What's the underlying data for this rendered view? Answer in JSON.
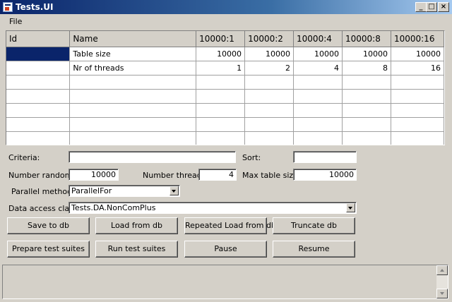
{
  "window": {
    "title": "Tests.UI",
    "minimize_glyph": "_",
    "maximize_glyph": "□",
    "close_glyph": "×"
  },
  "menu": {
    "file": "File"
  },
  "grid": {
    "columns": [
      "Id",
      "Name",
      "10000:1",
      "10000:2",
      "10000:4",
      "10000:8",
      "10000:16"
    ],
    "rows": [
      [
        "",
        "Table size",
        "10000",
        "10000",
        "10000",
        "10000",
        "10000"
      ],
      [
        "",
        "Nr of threads",
        "1",
        "2",
        "4",
        "8",
        "16"
      ]
    ]
  },
  "form": {
    "criteria_label": "Criteria:",
    "criteria_value": "",
    "sort_label": "Sort:",
    "sort_value": "",
    "number_randoms_label": "Number randoms:",
    "number_randoms_value": "10000",
    "number_threads_label": "Number threads:",
    "number_threads_value": "4",
    "max_table_size_label": "Max table size:",
    "max_table_size_value": "10000",
    "parallel_method_label": "Parallel method:",
    "parallel_method_value": "ParallelFor",
    "data_access_label": "Data access class:",
    "data_access_value": "Tests.DA.NonComPlus"
  },
  "buttons": {
    "save_to_db": "Save to db",
    "load_from_db": "Load from db",
    "repeated_load": "Repeated Load from db",
    "truncate_db": "Truncate db",
    "prepare_suites": "Prepare test suites",
    "run_suites": "Run test suites",
    "pause": "Pause",
    "resume": "Resume"
  },
  "colors": {
    "title_bar": "#0a246a",
    "selection": "#0a246a",
    "face": "#d4d0c8"
  }
}
